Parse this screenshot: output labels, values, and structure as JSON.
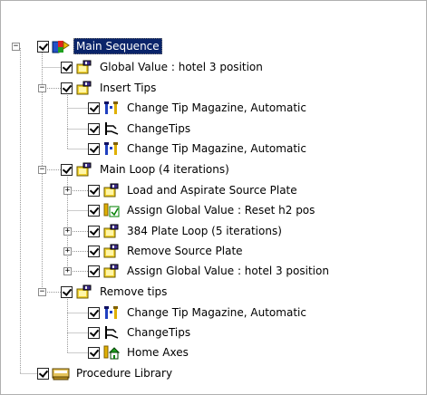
{
  "tree": {
    "accent_color": "#0a246a",
    "nodes": [
      {
        "label": "Main Sequence",
        "icon": "main-sequence-icon",
        "checked": true,
        "expander": "−",
        "selected": true
      },
      {
        "label": "Global Value : hotel 3 position",
        "icon": "folder-icon",
        "checked": true,
        "expander": ""
      },
      {
        "label": "Insert Tips",
        "icon": "folder-icon",
        "checked": true,
        "expander": "−"
      },
      {
        "label": "Change Tip Magazine, Automatic",
        "icon": "tip-magazine-icon",
        "checked": true,
        "expander": ""
      },
      {
        "label": "ChangeTips",
        "icon": "change-tips-icon",
        "checked": true,
        "expander": ""
      },
      {
        "label": "Change Tip Magazine, Automatic",
        "icon": "tip-magazine-icon",
        "checked": true,
        "expander": ""
      },
      {
        "label": "Main Loop (4 iterations)",
        "icon": "folder-icon",
        "checked": true,
        "expander": "−"
      },
      {
        "label": "Load and Aspirate Source Plate",
        "icon": "folder-icon",
        "checked": true,
        "expander": "+"
      },
      {
        "label": "Assign Global Value : Reset h2 pos",
        "icon": "assign-value-icon",
        "checked": true,
        "expander": ""
      },
      {
        "label": "384 Plate Loop (5 iterations)",
        "icon": "folder-icon",
        "checked": true,
        "expander": "+"
      },
      {
        "label": "Remove Source Plate",
        "icon": "folder-icon",
        "checked": true,
        "expander": "+"
      },
      {
        "label": "Assign Global Value : hotel 3 position",
        "icon": "folder-icon",
        "checked": true,
        "expander": "+"
      },
      {
        "label": "Remove tips",
        "icon": "folder-icon",
        "checked": true,
        "expander": "−"
      },
      {
        "label": "Change Tip Magazine, Automatic",
        "icon": "tip-magazine-icon",
        "checked": true,
        "expander": ""
      },
      {
        "label": "ChangeTips",
        "icon": "change-tips-icon",
        "checked": true,
        "expander": ""
      },
      {
        "label": "Home Axes",
        "icon": "home-axes-icon",
        "checked": true,
        "expander": ""
      },
      {
        "label": "Procedure Library",
        "icon": "procedure-library-icon",
        "checked": true,
        "expander": ""
      }
    ]
  }
}
